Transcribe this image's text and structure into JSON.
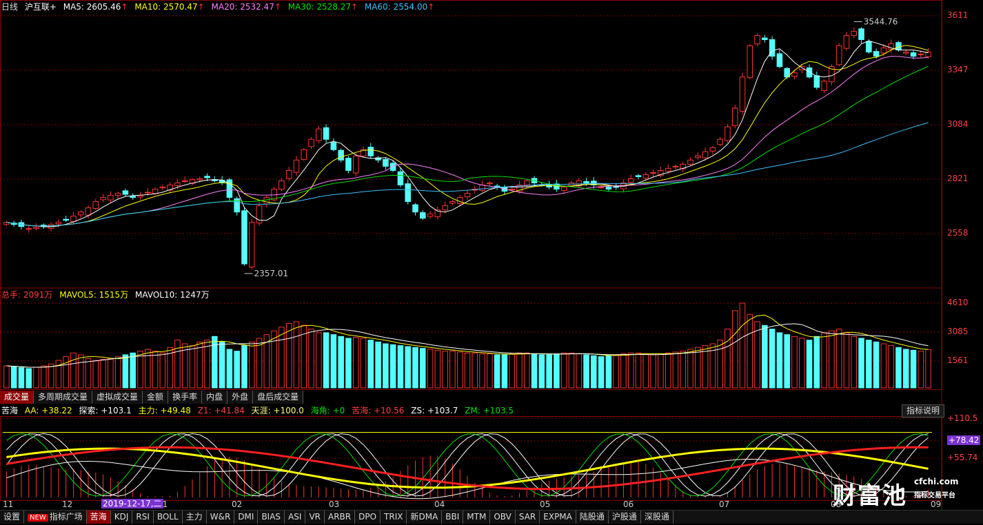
{
  "main_legend": {
    "period": "日线",
    "symbol": "沪互联+",
    "ma5": "MA5: 2605.46",
    "ma10": "MA10: 2570.47",
    "ma20": "MA20: 2532.47",
    "ma30": "MA30: 2528.27",
    "ma60": "MA60: 2554.00",
    "up_arrow": "↑"
  },
  "price_axis": [
    "3611",
    "3347",
    "3084",
    "2821",
    "2558"
  ],
  "annotations": {
    "high": "3544.76",
    "low": "2357.01"
  },
  "volume_legend": {
    "total": "总手: 2091万",
    "mavol5": "MAVOL5: 1515万",
    "mavol10": "MAVOL10: 1247万"
  },
  "volume_axis": [
    "4610",
    "3085",
    "1561"
  ],
  "volume_tabs": [
    "成交量",
    "多周期成交量",
    "虚拟成交量",
    "金额",
    "换手率",
    "内盘",
    "外盘",
    "盘后成交量"
  ],
  "indicator_legend": {
    "name": "苦海",
    "aa": "AA: +38.22",
    "tansuo": "探索: +103.1",
    "zhuli": "主力: +49.48",
    "z1": "Z1: +41.84",
    "tianya": "天涯: +100.0",
    "haijiao": "海角: +0",
    "kuhai": "苦海: +10.56",
    "zs": "ZS: +103.7",
    "zm": "ZM: +103.5"
  },
  "indicator_axis": [
    "+110.5",
    "+78.42",
    "+55.74"
  ],
  "explain_button": "指标说明",
  "x_axis": [
    "11",
    "12",
    "01",
    "02",
    "03",
    "04",
    "05",
    "06",
    "07",
    "08",
    "09"
  ],
  "date_tag": "2019-12-17,二",
  "logo": {
    "main": "财富池",
    "site": "cfchi.com",
    "tagline": "指标交易平台"
  },
  "bottom_tabs": [
    "设置",
    "指标广场",
    "苦海",
    "KDJ",
    "RSI",
    "BOLL",
    "主力",
    "W&R",
    "DMI",
    "BIAS",
    "ASI",
    "VR",
    "ARBR",
    "DPO",
    "TRIX",
    "新DMA",
    "BBI",
    "MTM",
    "OBV",
    "SAR",
    "EXPMA",
    "陆股通",
    "沪股通",
    "深股通"
  ],
  "bottom_new_badge": "NEW",
  "colors": {
    "up": "#ff3232",
    "down": "#54ffff",
    "ma5": "#ffffff",
    "ma10": "#ffff00",
    "ma20": "#ff80ff",
    "ma30": "#00e000",
    "ma60": "#40c0ff",
    "grid": "#8b0000"
  },
  "chart_data": {
    "type": "candlestick",
    "price_range": [
      2357.01,
      3611
    ],
    "closes": [
      2600,
      2590,
      2580,
      2570,
      2575,
      2580,
      2590,
      2600,
      2610,
      2630,
      2650,
      2670,
      2700,
      2720,
      2730,
      2740,
      2735,
      2720,
      2730,
      2745,
      2760,
      2770,
      2780,
      2790,
      2800,
      2805,
      2810,
      2815,
      2800,
      2790,
      2720,
      2650,
      2400,
      2600,
      2680,
      2720,
      2760,
      2800,
      2850,
      2900,
      2950,
      3000,
      3050,
      3000,
      2950,
      2900,
      2850,
      2920,
      2950,
      2920,
      2900,
      2870,
      2850,
      2780,
      2700,
      2650,
      2620,
      2640,
      2660,
      2680,
      2700,
      2720,
      2740,
      2760,
      2780,
      2790,
      2770,
      2750,
      2760,
      2780,
      2800,
      2790,
      2780,
      2770,
      2760,
      2770,
      2790,
      2800,
      2790,
      2780,
      2770,
      2760,
      2770,
      2790,
      2810,
      2820,
      2830,
      2840,
      2850,
      2860,
      2870,
      2880,
      2900,
      2920,
      2940,
      2960,
      3000,
      3060,
      3150,
      3300,
      3450,
      3500,
      3480,
      3400,
      3350,
      3300,
      3320,
      3350,
      3300,
      3250,
      3280,
      3350,
      3450,
      3500,
      3520,
      3480,
      3420,
      3400,
      3440,
      3460,
      3430,
      3420,
      3400,
      3410,
      3420
    ],
    "volume_range": [
      0,
      4610
    ],
    "volumes_wan": [
      1200,
      1150,
      1100,
      1050,
      1120,
      1200,
      1300,
      1500,
      1700,
      1900,
      1800,
      1600,
      1500,
      1550,
      1600,
      1700,
      1800,
      1900,
      2000,
      2100,
      2000,
      1900,
      2200,
      2600,
      2400,
      2300,
      2500,
      2600,
      2800,
      2500,
      2100,
      2000,
      2300,
      2500,
      2700,
      2900,
      3100,
      3300,
      3500,
      3600,
      3400,
      3200,
      3000,
      3000,
      2900,
      2800,
      2700,
      2750,
      2700,
      2600,
      2500,
      2400,
      2350,
      2300,
      2250,
      2200,
      2150,
      2100,
      2050,
      2000,
      2000,
      1950,
      1900,
      1900,
      1850,
      1850,
      1800,
      1800,
      1850,
      1900,
      1900,
      1850,
      1800,
      1800,
      1850,
      1900,
      1900,
      1850,
      1800,
      1750,
      1700,
      1750,
      1800,
      1850,
      1900,
      1900,
      1850,
      1800,
      1850,
      1900,
      1950,
      2000,
      2100,
      2200,
      2300,
      2400,
      2600,
      3200,
      4200,
      4610,
      4000,
      3600,
      3400,
      3200,
      3000,
      2900,
      2800,
      2700,
      2600,
      2800,
      3000,
      3100,
      3200,
      3000,
      2800,
      2700,
      2600,
      2500,
      2400,
      2300,
      2200,
      2100,
      2050,
      2000,
      2091
    ]
  }
}
